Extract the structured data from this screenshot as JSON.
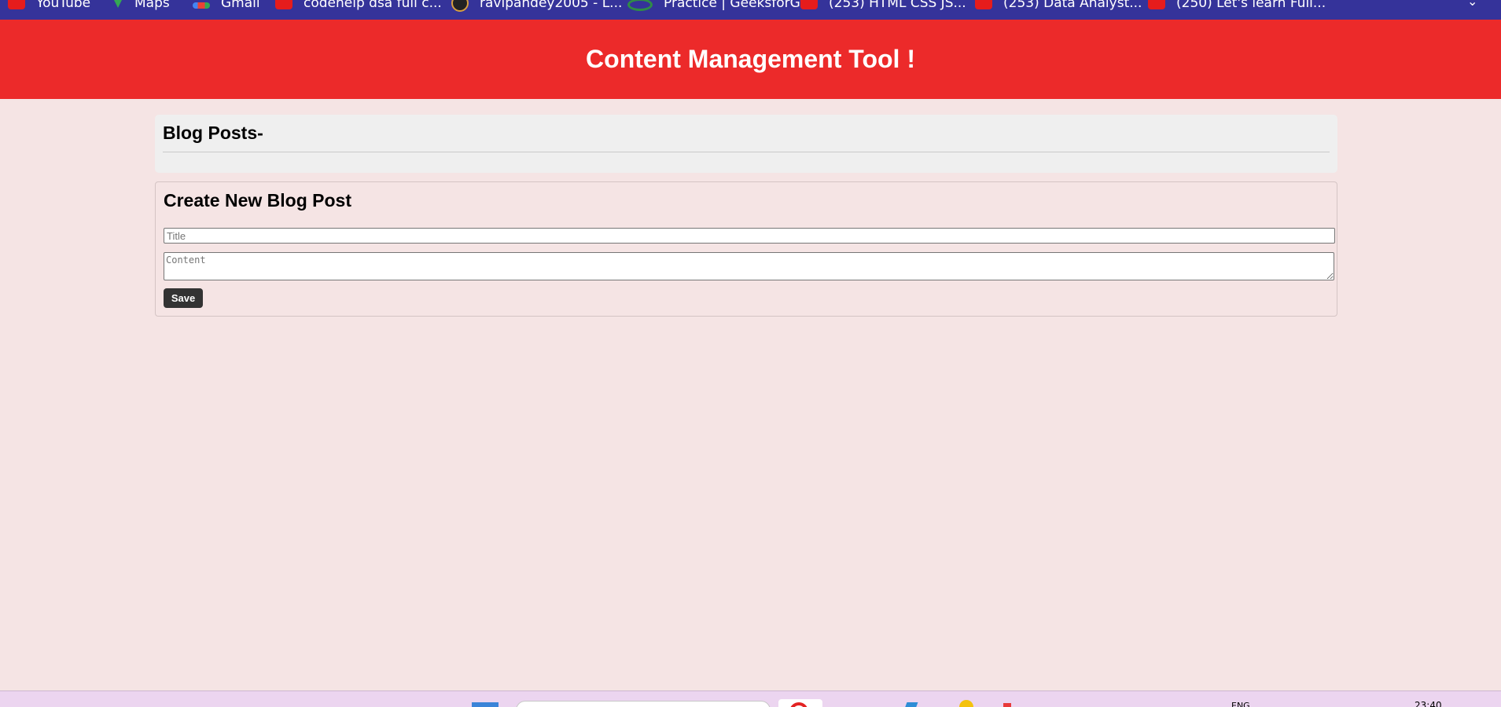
{
  "bookmarks": [
    {
      "label": "YouTube",
      "icon": "youtube-icon"
    },
    {
      "label": "Maps",
      "icon": "maps-icon"
    },
    {
      "label": "Gmail",
      "icon": "gmail-icon"
    },
    {
      "label": "codehelp dsa full c...",
      "icon": "youtube-icon"
    },
    {
      "label": "ravipandey2005 - L...",
      "icon": "avatar-icon"
    },
    {
      "label": "Practice | GeeksforG...",
      "icon": "geeksforgeeks-icon"
    },
    {
      "label": "(253) HTML CSS JS...",
      "icon": "youtube-icon"
    },
    {
      "label": "(253) Data Analyst...",
      "icon": "youtube-icon"
    },
    {
      "label": "(250) Let's learn Full...",
      "icon": "youtube-icon"
    }
  ],
  "header": {
    "title": "Content Management Tool !",
    "background": "#ec2a2a"
  },
  "posts": {
    "heading": "Blog Posts-"
  },
  "create": {
    "heading": "Create New Blog Post",
    "title_placeholder": "Title",
    "title_value": "",
    "content_placeholder": "Content",
    "content_value": "",
    "save_label": "Save"
  },
  "taskbar": {
    "language": "ENG",
    "time": "23:40"
  },
  "colors": {
    "bookmarks_bar": "#35339a",
    "page_background": "#f5e4e4",
    "posts_panel": "#efefef",
    "save_button": "#333333",
    "taskbar": "#ecd5f0"
  }
}
